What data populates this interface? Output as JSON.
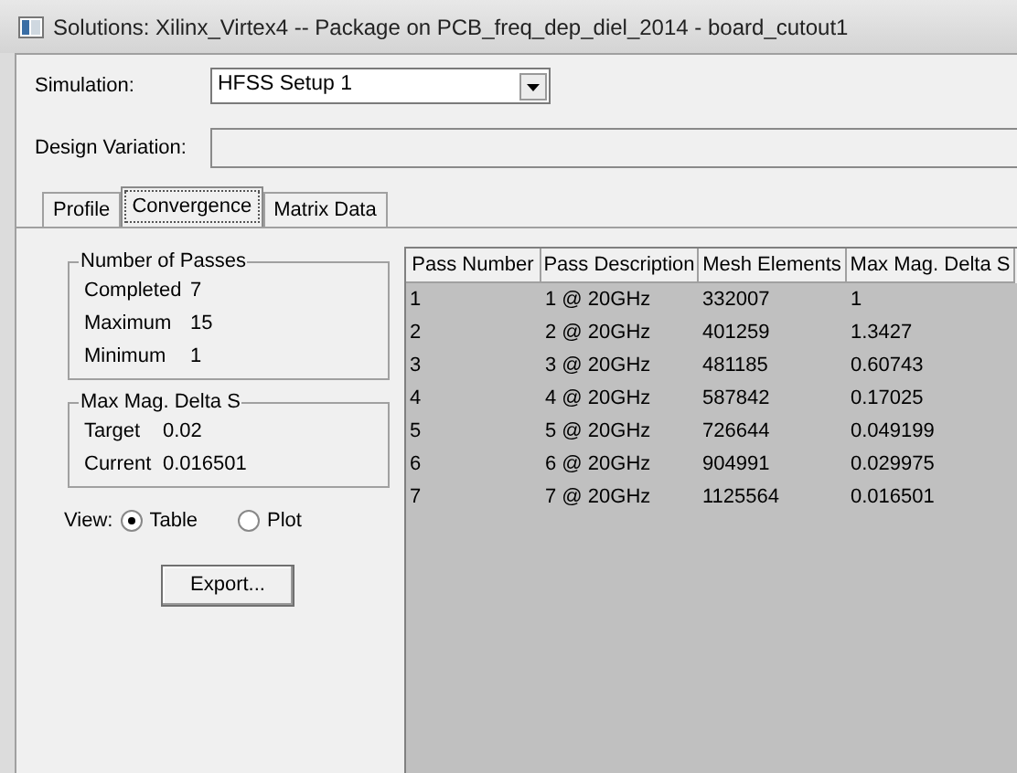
{
  "window": {
    "title": "Solutions: Xilinx_Virtex4 -- Package on PCB_freq_dep_diel_2014 - board_cutout1"
  },
  "simulation": {
    "label": "Simulation:",
    "value": "HFSS Setup 1"
  },
  "design_variation": {
    "label": "Design Variation:"
  },
  "tabs": [
    {
      "label": "Profile",
      "selected": false
    },
    {
      "label": "Convergence",
      "selected": true
    },
    {
      "label": "Matrix Data",
      "selected": false
    }
  ],
  "passes_group": {
    "title": "Number of Passes",
    "rows": [
      {
        "label": "Completed",
        "value": "7"
      },
      {
        "label": "Maximum",
        "value": "15"
      },
      {
        "label": "Minimum",
        "value": "1"
      }
    ]
  },
  "delta_group": {
    "title": "Max Mag. Delta S",
    "rows": [
      {
        "label": "Target",
        "value": "0.02"
      },
      {
        "label": "Current",
        "value": "0.016501"
      }
    ]
  },
  "view": {
    "label": "View:",
    "options": [
      {
        "label": "Table",
        "selected": true
      },
      {
        "label": "Plot",
        "selected": false
      }
    ]
  },
  "export_button": "Export...",
  "table": {
    "columns": [
      "Pass Number",
      "Pass Description",
      "Mesh Elements",
      "Max Mag. Delta S"
    ],
    "rows": [
      [
        "1",
        "1 @ 20GHz",
        "332007",
        "1"
      ],
      [
        "2",
        "2 @ 20GHz",
        "401259",
        "1.3427"
      ],
      [
        "3",
        "3 @ 20GHz",
        "481185",
        "0.60743"
      ],
      [
        "4",
        "4 @ 20GHz",
        "587842",
        "0.17025"
      ],
      [
        "5",
        "5 @ 20GHz",
        "726644",
        "0.049199"
      ],
      [
        "6",
        "6 @ 20GHz",
        "904991",
        "0.029975"
      ],
      [
        "7",
        "7 @ 20GHz",
        "1125564",
        "0.016501"
      ]
    ]
  }
}
